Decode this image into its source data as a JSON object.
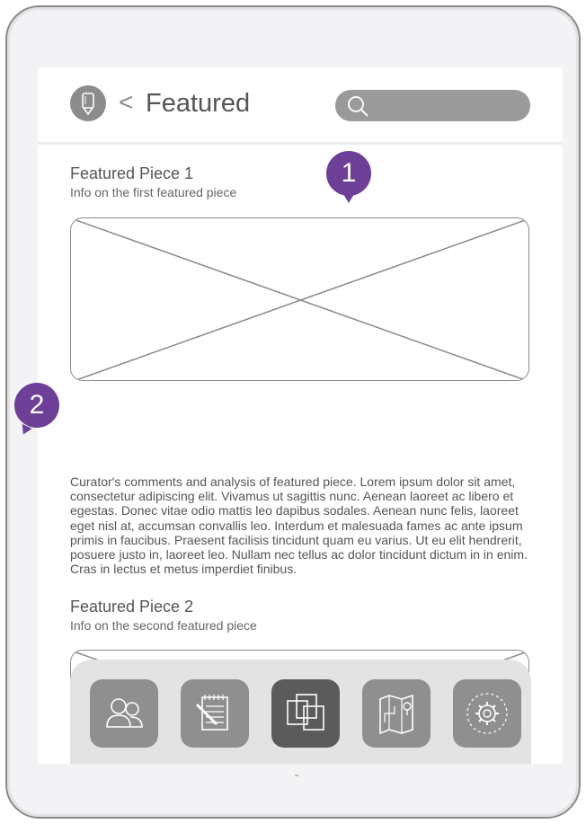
{
  "header": {
    "back_glyph": "<",
    "title": "Featured",
    "search_placeholder": ""
  },
  "pieces": [
    {
      "title": "Featured Piece 1",
      "info": "Info on the first featured piece"
    },
    {
      "title": "Featured Piece 2",
      "info": "Info on the second featured piece"
    }
  ],
  "comments": "Curator's comments and analysis of featured piece. Lorem ipsum dolor sit amet, consectetur adipiscing elit. Vivamus ut sagittis nunc. Aenean laoreet ac libero et egestas. Donec vitae odio mattis leo dapibus sodales. Aenean nunc felis, laoreet eget nisl at, accumsan convallis leo. Interdum et malesuada fames ac ante ipsum primis in faucibus. Praesent facilisis tincidunt quam eu varius. Ut eu elit hendrerit, posuere justo in, laoreet leo. Nullam nec tellus ac dolor tincidunt dictum in in enim. Cras in lectus et metus imperdiet finibus.",
  "markers": [
    "1",
    "2"
  ],
  "tabbar": {
    "tabs": [
      {
        "icon": "people-icon",
        "active": false
      },
      {
        "icon": "notepad-icon",
        "active": false
      },
      {
        "icon": "gallery-icon",
        "active": true
      },
      {
        "icon": "map-icon",
        "active": false
      },
      {
        "icon": "settings-icon",
        "active": false
      }
    ]
  },
  "colors": {
    "accent": "#6d3f97",
    "icon_gray": "#8f8f8f",
    "active_tab": "#5b5b5b"
  }
}
